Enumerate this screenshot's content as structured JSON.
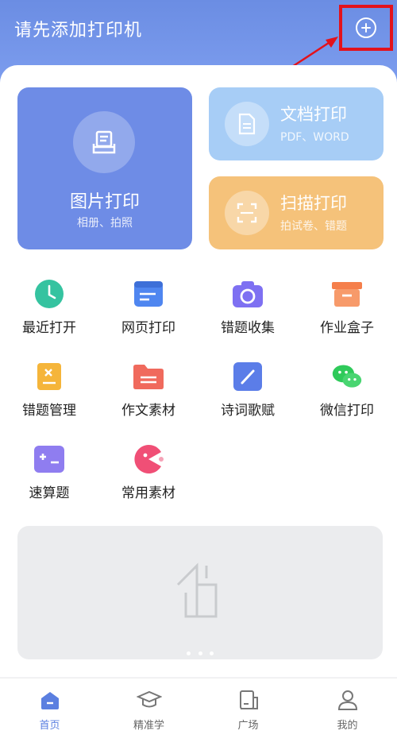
{
  "header": {
    "title": "请先添加打印机"
  },
  "cards": {
    "photo": {
      "title": "图片打印",
      "subtitle": "相册、拍照"
    },
    "document": {
      "title": "文档打印",
      "subtitle": "PDF、WORD"
    },
    "scan": {
      "title": "扫描打印",
      "subtitle": "拍试卷、错题"
    }
  },
  "grid": [
    {
      "label": "最近打开",
      "icon": "clock-icon",
      "color": "#35c3a0"
    },
    {
      "label": "网页打印",
      "icon": "webpage-icon",
      "color": "#4f86f0"
    },
    {
      "label": "错题收集",
      "icon": "camera-icon",
      "color": "#7e70f2"
    },
    {
      "label": "作业盒子",
      "icon": "box-icon",
      "color": "#f57f4b"
    },
    {
      "label": "错题管理",
      "icon": "mistake-doc-icon",
      "color": "#f5b53a"
    },
    {
      "label": "作文素材",
      "icon": "folder-icon",
      "color": "#f06a5d"
    },
    {
      "label": "诗词歌赋",
      "icon": "pen-icon",
      "color": "#5b7de8"
    },
    {
      "label": "微信打印",
      "icon": "wechat-icon",
      "color": "#2fca5a"
    },
    {
      "label": "速算题",
      "icon": "math-icon",
      "color": "#8f7df0"
    },
    {
      "label": "常用素材",
      "icon": "material-icon",
      "color": "#f04f76"
    }
  ],
  "tabs": [
    {
      "label": "首页",
      "icon": "home-icon",
      "active": true
    },
    {
      "label": "精准学",
      "icon": "graduation-cap-icon",
      "active": false
    },
    {
      "label": "广场",
      "icon": "plaza-icon",
      "active": false
    },
    {
      "label": "我的",
      "icon": "user-icon",
      "active": false
    }
  ],
  "colors": {
    "accent": "#6e8ce6",
    "highlight_box": "#e3121b"
  }
}
